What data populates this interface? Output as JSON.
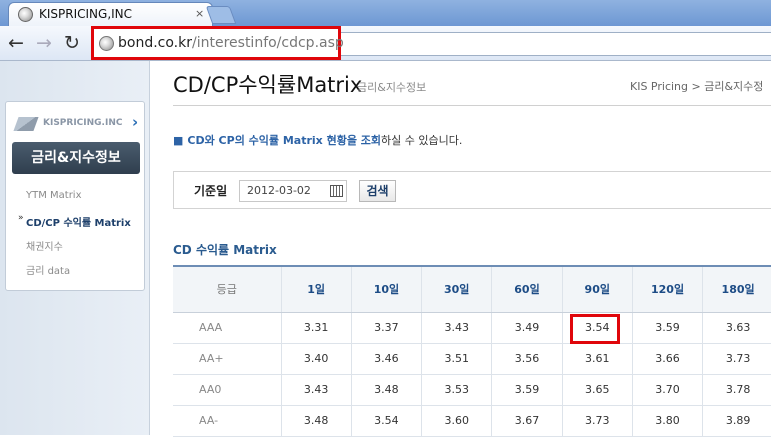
{
  "browser": {
    "tab_title": "KISPRICING,INC",
    "tab_close": "×",
    "url_host": "bond.co.kr",
    "url_path": "/interestinfo/cdcp.asp",
    "back_glyph": "←",
    "forward_glyph": "→",
    "reload_glyph": "↻"
  },
  "sidebar": {
    "logo_text": "KISPRICING.INC",
    "title": "금리&지수정보",
    "items": [
      {
        "label": "YTM Matrix",
        "active": false
      },
      {
        "label": "CD/CP 수익률 Matrix",
        "active": true
      },
      {
        "label": "채권지수",
        "active": false
      },
      {
        "label": "금리 data",
        "active": false
      }
    ]
  },
  "header": {
    "title": "CD/CP수익률Matrix",
    "subtitle": "금리&지수정보",
    "breadcrumb": "KIS Pricing  >  금리&지수정"
  },
  "description": {
    "strong": "CD와 CP의 수익률 Matrix 현황을 조회",
    "rest": "하실 수 있습니다."
  },
  "search": {
    "label": "기준일",
    "date_value": "2012-03-02",
    "button": "검색"
  },
  "table": {
    "section_title": "CD 수익률 Matrix",
    "grade_header": "등급",
    "columns": [
      "1일",
      "10일",
      "30일",
      "60일",
      "90일",
      "120일",
      "180일"
    ],
    "rows": [
      {
        "grade": "AAA",
        "values": [
          "3.31",
          "3.37",
          "3.43",
          "3.49",
          "3.54",
          "3.59",
          "3.63"
        ]
      },
      {
        "grade": "AA+",
        "values": [
          "3.40",
          "3.46",
          "3.51",
          "3.56",
          "3.61",
          "3.66",
          "3.73"
        ]
      },
      {
        "grade": "AA0",
        "values": [
          "3.43",
          "3.48",
          "3.53",
          "3.59",
          "3.65",
          "3.70",
          "3.78"
        ]
      },
      {
        "grade": "AA-",
        "values": [
          "3.48",
          "3.54",
          "3.60",
          "3.67",
          "3.73",
          "3.80",
          "3.89"
        ]
      }
    ],
    "highlighted_cell": {
      "row": 0,
      "column": 4
    }
  },
  "colors": {
    "highlight_red": "#e0060b",
    "header_blue": "#1d4c86",
    "sidebar_title_bg": "#3a4b5c"
  }
}
